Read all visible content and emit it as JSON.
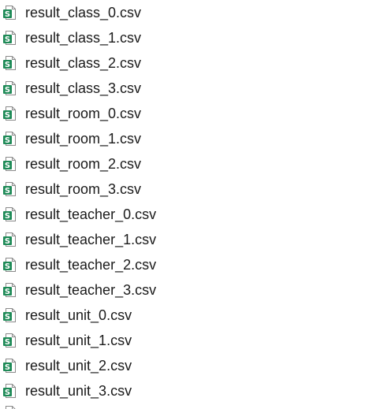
{
  "files": [
    {
      "name": "result_class_0.csv",
      "icon": "spreadsheet-csv-icon"
    },
    {
      "name": "result_class_1.csv",
      "icon": "spreadsheet-csv-icon"
    },
    {
      "name": "result_class_2.csv",
      "icon": "spreadsheet-csv-icon"
    },
    {
      "name": "result_class_3.csv",
      "icon": "spreadsheet-csv-icon"
    },
    {
      "name": "result_room_0.csv",
      "icon": "spreadsheet-csv-icon"
    },
    {
      "name": "result_room_1.csv",
      "icon": "spreadsheet-csv-icon"
    },
    {
      "name": "result_room_2.csv",
      "icon": "spreadsheet-csv-icon"
    },
    {
      "name": "result_room_3.csv",
      "icon": "spreadsheet-csv-icon"
    },
    {
      "name": "result_teacher_0.csv",
      "icon": "spreadsheet-csv-icon"
    },
    {
      "name": "result_teacher_1.csv",
      "icon": "spreadsheet-csv-icon"
    },
    {
      "name": "result_teacher_2.csv",
      "icon": "spreadsheet-csv-icon"
    },
    {
      "name": "result_teacher_3.csv",
      "icon": "spreadsheet-csv-icon"
    },
    {
      "name": "result_unit_0.csv",
      "icon": "spreadsheet-csv-icon"
    },
    {
      "name": "result_unit_1.csv",
      "icon": "spreadsheet-csv-icon"
    },
    {
      "name": "result_unit_2.csv",
      "icon": "spreadsheet-csv-icon"
    },
    {
      "name": "result_unit_3.csv",
      "icon": "spreadsheet-csv-icon"
    }
  ],
  "colors": {
    "icon_accent": "#1e8a57",
    "icon_page": "#ffffff",
    "icon_border": "#8a8a8a",
    "text": "#1a1a1a"
  }
}
